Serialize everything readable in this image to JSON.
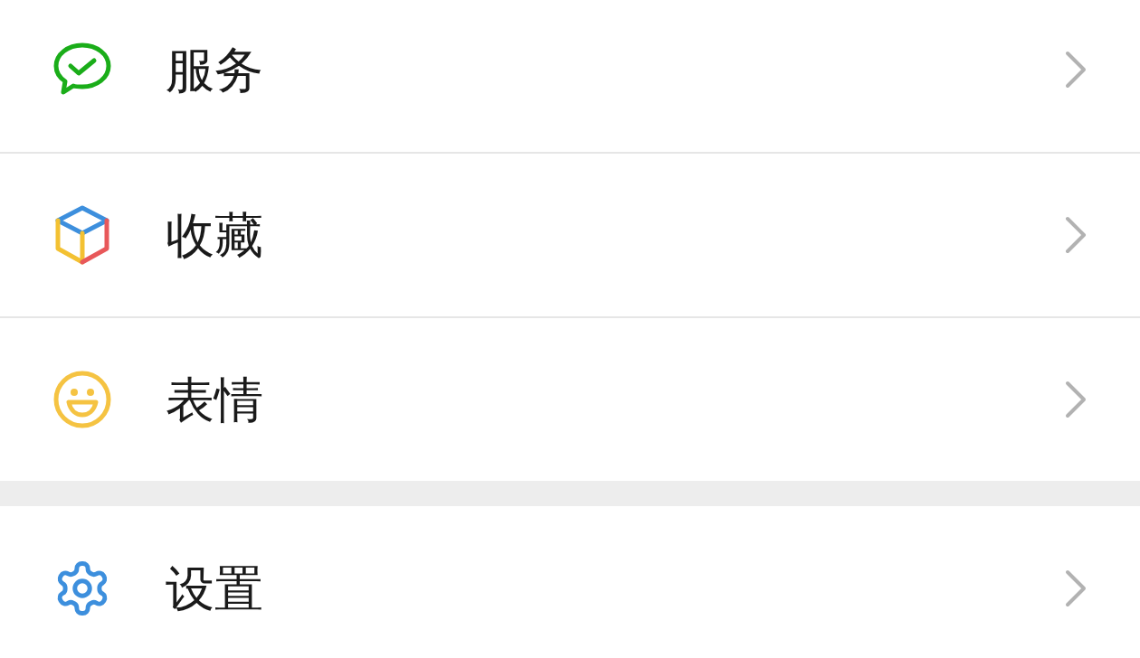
{
  "groups": [
    {
      "items": [
        {
          "label": "服务"
        },
        {
          "label": "收藏"
        },
        {
          "label": "表情"
        }
      ]
    },
    {
      "items": [
        {
          "label": "设置"
        }
      ]
    }
  ]
}
